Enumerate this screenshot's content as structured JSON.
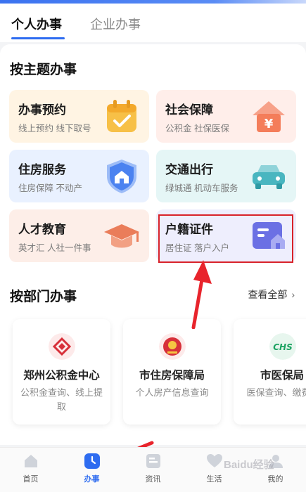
{
  "tabs": {
    "personal": "个人办事",
    "enterprise": "企业办事"
  },
  "sections": {
    "by_topic": "按主题办事",
    "by_department": "按部门办事",
    "view_all": "查看全部"
  },
  "topics": [
    {
      "title": "办事预约",
      "subtitle": "线上预约 线下取号",
      "icon": "calendar-check-icon",
      "bg": "#fff4e3",
      "accent": "#f7b733"
    },
    {
      "title": "社会保障",
      "subtitle": "公积金 社保医保",
      "icon": "house-yuan-icon",
      "bg": "#ffeeea",
      "accent": "#f47d5a"
    },
    {
      "title": "住房服务",
      "subtitle": "住房保障 不动产",
      "icon": "house-shield-icon",
      "bg": "#e9f1ff",
      "accent": "#4b82f0"
    },
    {
      "title": "交通出行",
      "subtitle": "绿城通 机动车服务",
      "icon": "car-icon",
      "bg": "#e5f6f6",
      "accent": "#49b6c0"
    },
    {
      "title": "人才教育",
      "subtitle": "英才汇 人社一件事",
      "icon": "graduation-cap-icon",
      "bg": "#fdeee8",
      "accent": "#ea7d5a"
    },
    {
      "title": "户籍证件",
      "subtitle": "居住证 落户入户",
      "icon": "id-card-house-icon",
      "bg": "#eeeefd",
      "accent": "#6b70e4"
    }
  ],
  "departments": [
    {
      "name": "郑州公积金中心",
      "desc": "公积金查询、线上提取",
      "logo": "housing-fund-logo"
    },
    {
      "name": "市住房保障局",
      "desc": "个人房产信息查询",
      "logo": "national-emblem-logo"
    },
    {
      "name": "市医保局",
      "desc": "医保查询、缴费",
      "logo": "chs-logo",
      "logo_text": "CHS"
    }
  ],
  "bottom_nav": [
    {
      "label": "首页",
      "icon": "home-icon",
      "active": false
    },
    {
      "label": "办事",
      "icon": "clock-icon",
      "active": true
    },
    {
      "label": "资讯",
      "icon": "news-icon",
      "active": false
    },
    {
      "label": "生活",
      "icon": "heart-icon",
      "active": false
    },
    {
      "label": "我的",
      "icon": "user-icon",
      "active": false
    }
  ],
  "watermark": "Baidu经验",
  "colors": {
    "primary": "#2e6cf0",
    "highlight_red": "#d8222a"
  }
}
